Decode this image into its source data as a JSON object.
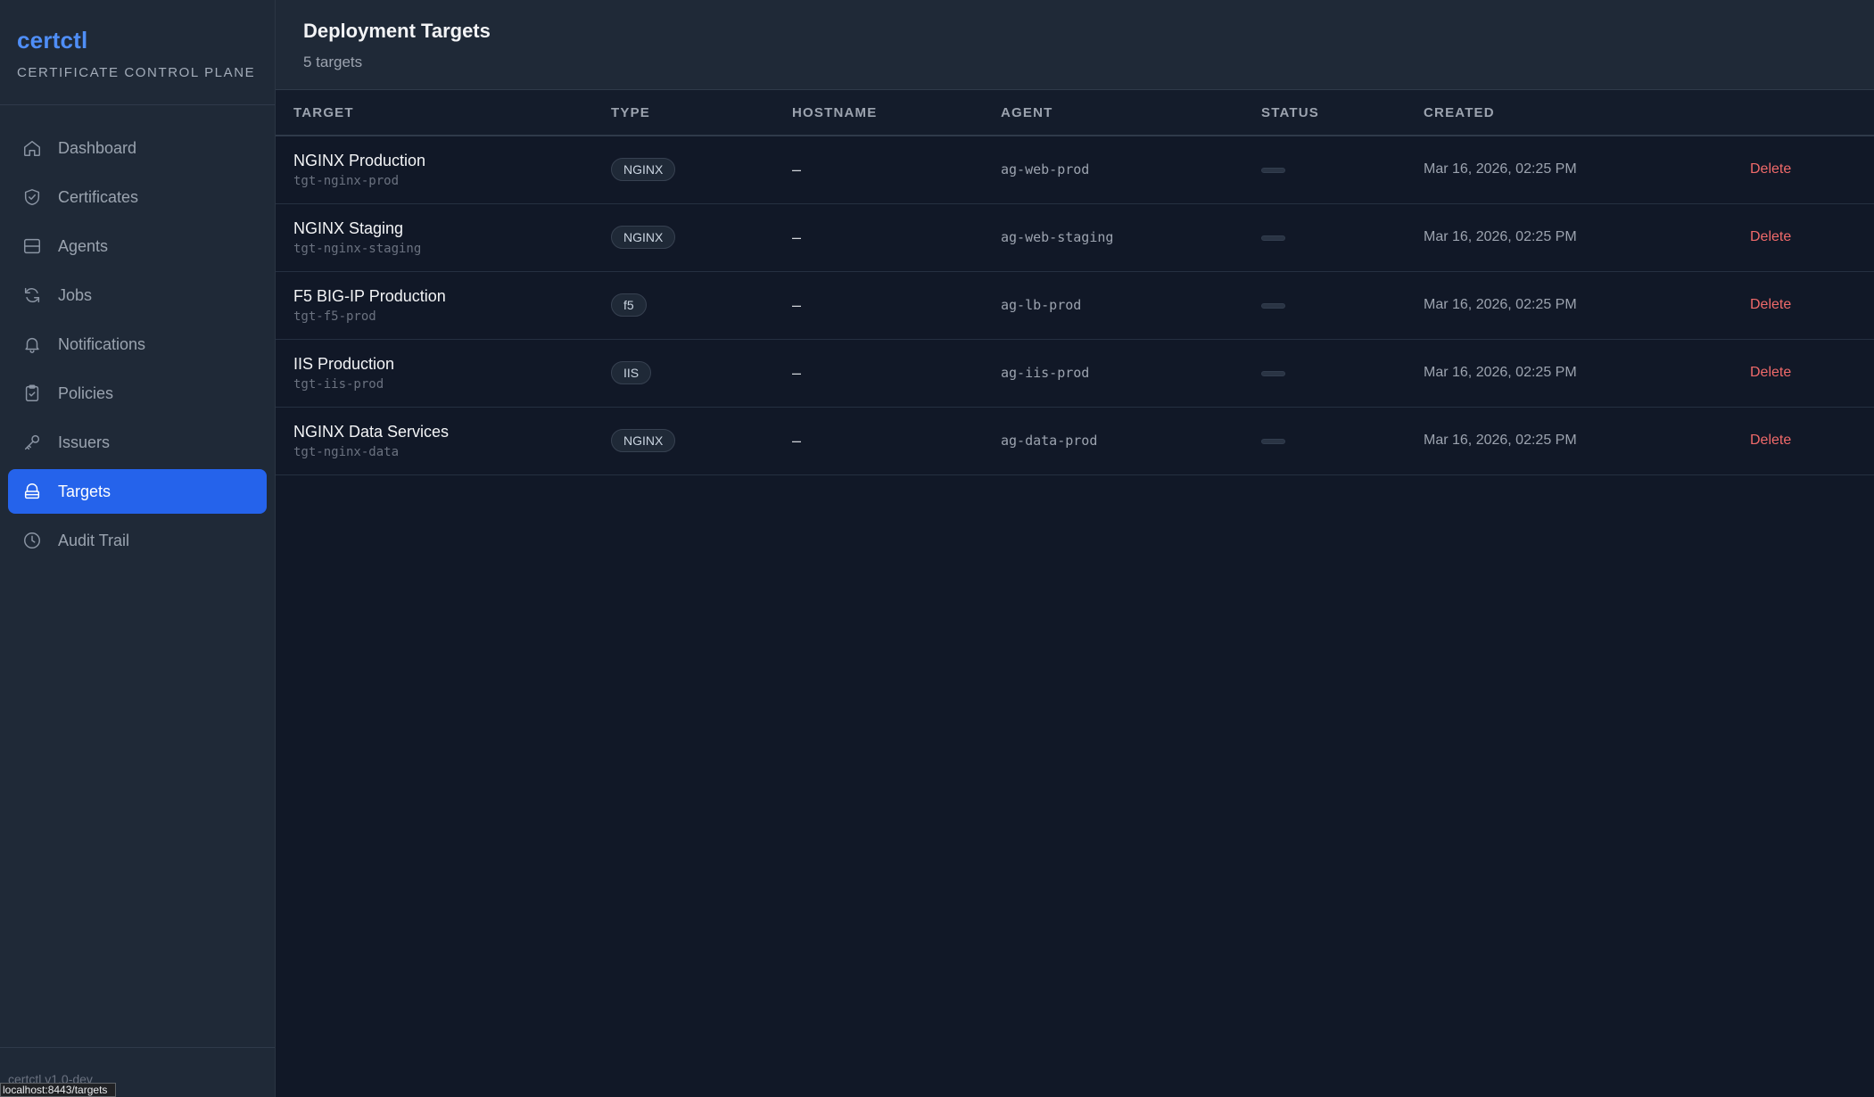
{
  "brand": {
    "name": "certctl",
    "subtitle": "CERTIFICATE CONTROL PLANE"
  },
  "sidebar": {
    "items": [
      {
        "label": "Dashboard",
        "icon": "home-icon",
        "active": false
      },
      {
        "label": "Certificates",
        "icon": "shield-check-icon",
        "active": false
      },
      {
        "label": "Agents",
        "icon": "server-icon",
        "active": false
      },
      {
        "label": "Jobs",
        "icon": "refresh-icon",
        "active": false
      },
      {
        "label": "Notifications",
        "icon": "bell-icon",
        "active": false
      },
      {
        "label": "Policies",
        "icon": "clipboard-check-icon",
        "active": false
      },
      {
        "label": "Issuers",
        "icon": "key-icon",
        "active": false
      },
      {
        "label": "Targets",
        "icon": "target-stack-icon",
        "active": true
      },
      {
        "label": "Audit Trail",
        "icon": "clock-icon",
        "active": false
      }
    ],
    "version": "certctl v1.0-dev"
  },
  "status_bar": {
    "url": "localhost:8443/targets"
  },
  "header": {
    "title": "Deployment Targets",
    "subtitle": "5 targets"
  },
  "table": {
    "columns": [
      "TARGET",
      "TYPE",
      "HOSTNAME",
      "AGENT",
      "STATUS",
      "CREATED"
    ],
    "rows": [
      {
        "name": "NGINX Production",
        "id": "tgt-nginx-prod",
        "type": "NGINX",
        "hostname": "–",
        "agent": "ag-web-prod",
        "created": "Mar 16, 2026, 02:25 PM",
        "action": "Delete"
      },
      {
        "name": "NGINX Staging",
        "id": "tgt-nginx-staging",
        "type": "NGINX",
        "hostname": "–",
        "agent": "ag-web-staging",
        "created": "Mar 16, 2026, 02:25 PM",
        "action": "Delete"
      },
      {
        "name": "F5 BIG-IP Production",
        "id": "tgt-f5-prod",
        "type": "f5",
        "hostname": "–",
        "agent": "ag-lb-prod",
        "created": "Mar 16, 2026, 02:25 PM",
        "action": "Delete"
      },
      {
        "name": "IIS Production",
        "id": "tgt-iis-prod",
        "type": "IIS",
        "hostname": "–",
        "agent": "ag-iis-prod",
        "created": "Mar 16, 2026, 02:25 PM",
        "action": "Delete"
      },
      {
        "name": "NGINX Data Services",
        "id": "tgt-nginx-data",
        "type": "NGINX",
        "hostname": "–",
        "agent": "ag-data-prod",
        "created": "Mar 16, 2026, 02:25 PM",
        "action": "Delete"
      }
    ]
  },
  "colors": {
    "accent": "#2563eb",
    "brand": "#4f8ef7",
    "danger": "#f06a6a",
    "background": "#111827",
    "panel": "#1f2937"
  }
}
